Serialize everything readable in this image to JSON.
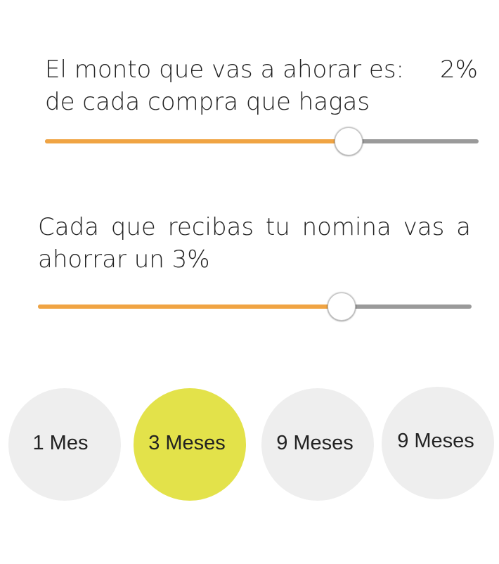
{
  "savings_per_purchase": {
    "text_line1": "El monto que vas a ahorar es:",
    "value_label": "2%",
    "text_line2": "de cada compra que hagas",
    "slider_value_fraction": 0.7
  },
  "salary_savings": {
    "text": "Cada que recibas tu nomina vas a ahorrar un 3%",
    "slider_value_fraction": 0.7
  },
  "periods": {
    "options": [
      "1 Mes",
      "3 Meses",
      "9 Meses",
      "9 Meses"
    ],
    "selected_index": 1
  },
  "colors": {
    "slider_fill": "#f0a443",
    "slider_track": "#9a9a9a",
    "selected_option": "#e3e24a",
    "option_background": "#eeeeee"
  }
}
